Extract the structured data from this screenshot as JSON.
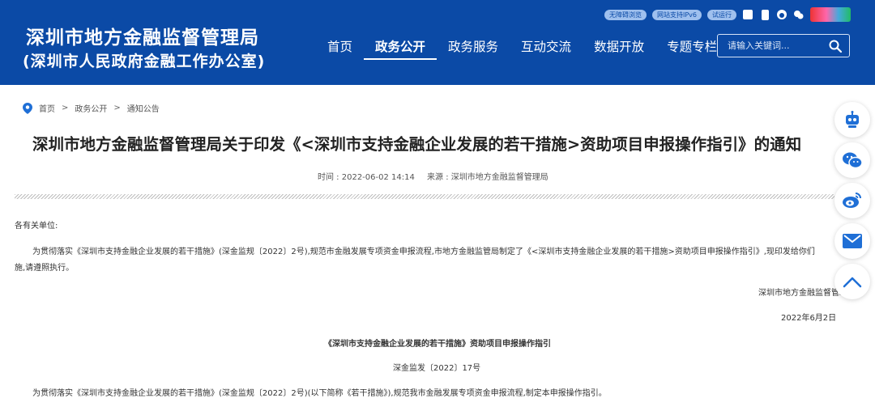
{
  "header": {
    "org_name": "深圳市地方金融监督管理局",
    "org_subname": "(深圳市人民政府金融工作办公室)",
    "top_links": [
      "无障碍浏览",
      "网站支持IPv6",
      "试运行"
    ],
    "nav": [
      {
        "label": "首页",
        "active": false
      },
      {
        "label": "政务公开",
        "active": true
      },
      {
        "label": "政务服务",
        "active": false
      },
      {
        "label": "互动交流",
        "active": false
      },
      {
        "label": "数据开放",
        "active": false
      },
      {
        "label": "专题专栏",
        "active": false
      }
    ],
    "search": {
      "placeholder": "请输入关键词..."
    }
  },
  "breadcrumb": {
    "items": [
      "首页",
      "政务公开",
      "通知公告"
    ],
    "separator": ">"
  },
  "article": {
    "title": "深圳市地方金融监督管理局关于印发《<深圳市支持金融企业发展的若干措施>资助项目申报操作指引》的通知",
    "time": "时间 : 2022-06-02 14:14",
    "source": "来源 : 深圳市地方金融监督管理局",
    "salutation": "各有关单位:",
    "para1_line1": "为贯彻落实《深圳市支持金融企业发展的若干措施》(深金监规〔2022〕2号),规范市金融发展专项资金申报流程,市地方金融监管局制定了《<深圳市支持金融企业发展的若干措施>资助项目申报操作指引》,现印发给你们",
    "para1_line2": "施,请遵照执行。",
    "signature": "深圳市地方金融监督管理局",
    "date": "2022年6月2日",
    "subtitle": "《深圳市支持金融企业发展的若干措施》资助项目申报操作指引",
    "doc_number": "深金监发〔2022〕17号",
    "para2_line1": "为贯彻落实《深圳市支持金融企业发展的若干措施》(深金监规〔2022〕2号)(以下简称《若干措施》),规范我市金融发展专项资金申报流程,制定本申报操作指引。"
  },
  "float_toolbar": [
    "robot-assistant",
    "wechat",
    "weibo",
    "email",
    "back-to-top"
  ],
  "colors": {
    "header_bg": "#0b4aa6",
    "accent": "#1f6fd6"
  }
}
